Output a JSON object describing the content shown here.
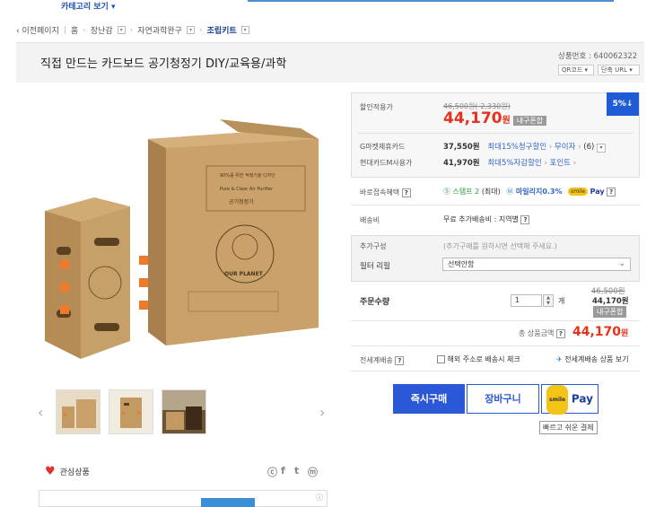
{
  "top": {
    "category_button": "카테고리 보기 ▾"
  },
  "breadcrumb": {
    "back": "‹ 이전페이지",
    "home": "홈",
    "level1": "장난감",
    "level2": "자연과학완구",
    "level3": "조립키트"
  },
  "product": {
    "title": "직접 만드는 카드보드 공기청정기 DIY/교육용/과학",
    "number_label": "상품번호 : 640062322",
    "qr_label": "QR코드",
    "short_url_label": "단축 URL"
  },
  "gallery": {
    "thumbnails": [
      "thumb-1",
      "thumb-2",
      "thumb-3"
    ],
    "box_brand": "OUR PLANET",
    "box_text1": "90%를 위한 적정기술 디자인",
    "box_text2": "Pure & Clear Air Purifier",
    "box_text3": "공기청정기"
  },
  "favorite": {
    "label": "관심상품"
  },
  "share": {
    "icons": [
      "ⓒ",
      "f",
      "t",
      "ⓜ"
    ]
  },
  "price": {
    "discount_label": "할인적용가",
    "original": "46,500원(-2,330원)",
    "sale_amount": "44,170",
    "sale_unit": "원",
    "coupon_badge": "내구폰합",
    "percent_badge": "5%↓",
    "card1_label": "G마켓제휴카드",
    "card1_price": "37,550원",
    "card1_benefit": "최대15%청구할인",
    "card1_installment": "무이자",
    "card1_count": "(6)",
    "card2_label": "현대카드M사용가",
    "card2_price": "41,970원",
    "card2_benefit": "최대5%자감할인",
    "card2_points": "포인트"
  },
  "benefits": {
    "label": "바로접속혜택",
    "stamp": "스탬프 2",
    "stamp_max": "(최대)",
    "mileage": "마일리지0.3%",
    "smile_pay": "Pay"
  },
  "shipping": {
    "label": "배송비",
    "value": "무료 추가배송비 : 지역별"
  },
  "options": {
    "extra_label": "추가구성",
    "extra_hint": "(추가구매를 원하시면 선택해 주세요.)",
    "filter_label": "필터 리필",
    "filter_value": "선택안함"
  },
  "order": {
    "qty_label": "주문수량",
    "qty_value": "1",
    "qty_unit": "개",
    "orig_price": "46,500원",
    "sale_price": "44,170원",
    "coupon": "내구폰합"
  },
  "total": {
    "label": "총 상품금액",
    "amount": "44,170",
    "unit": "원"
  },
  "global": {
    "label": "전세계배송",
    "overseas_check": "해외 주소로 배송시 체크",
    "link": "전세계배송 상품 보기"
  },
  "buttons": {
    "buy": "즉시구매",
    "cart": "장바구니",
    "smile": "smile",
    "pay": "Pay",
    "tooltip": "빠르고 쉬운 결제"
  },
  "colors": {
    "accent": "#2a58d6",
    "price": "#e8311a"
  }
}
